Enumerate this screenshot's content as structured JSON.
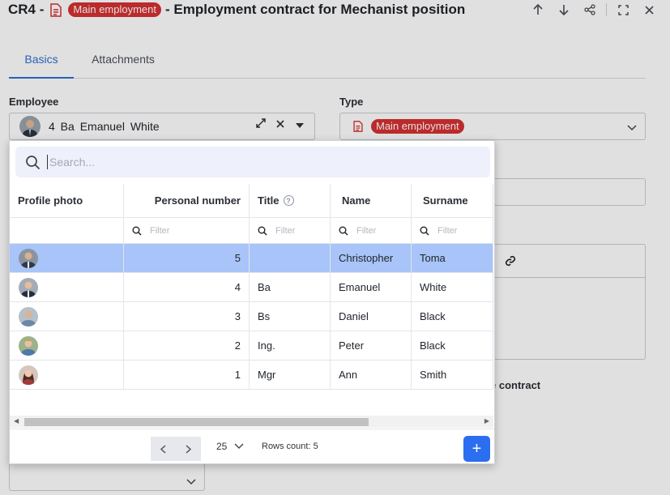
{
  "header": {
    "code": "CR4 -",
    "badge": "Main employment",
    "title": "- Employment contract for Mechanist position",
    "actions": [
      "arrow-up-icon",
      "arrow-down-icon",
      "share-icon",
      "fullscreen-icon",
      "close-icon"
    ]
  },
  "tabs": [
    {
      "label": "Basics",
      "active": true
    },
    {
      "label": "Attachments",
      "active": false
    }
  ],
  "form": {
    "employee_label": "Employee",
    "employee_value": "4 Ba Emanuel White",
    "type_label": "Type",
    "type_value": "Main employment",
    "partial_label": "e contract"
  },
  "search": {
    "placeholder": "Search...",
    "value": ""
  },
  "table": {
    "columns": [
      "Profile photo",
      "Personal number",
      "Title",
      "Name",
      "Surname"
    ],
    "filter_placeholder": "Filter",
    "rows": [
      {
        "number": "5",
        "title": "",
        "name": "Christopher",
        "surname": "Toma",
        "selected": true
      },
      {
        "number": "4",
        "title": "Ba",
        "name": "Emanuel",
        "surname": "White",
        "selected": false
      },
      {
        "number": "3",
        "title": "Bs",
        "name": "Daniel",
        "surname": "Black",
        "selected": false
      },
      {
        "number": "2",
        "title": "Ing.",
        "name": "Peter",
        "surname": "Black",
        "selected": false
      },
      {
        "number": "1",
        "title": "Mgr",
        "name": "Ann",
        "surname": "Smith",
        "selected": false
      }
    ]
  },
  "footer": {
    "page_size": "25",
    "rows_count": "Rows count: 5",
    "add_label": "+"
  },
  "colors": {
    "accent": "#2f6fd0",
    "badge": "#d63031",
    "selected_row": "#a8c4f8",
    "add_button": "#2b6ef0"
  }
}
